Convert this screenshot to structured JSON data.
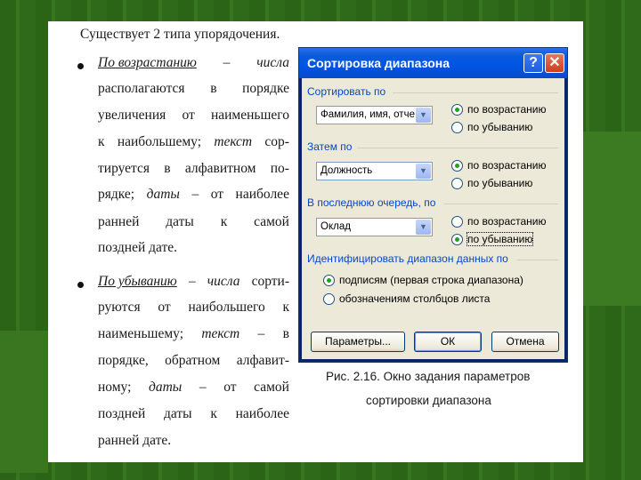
{
  "colors": {
    "background": "#2f6a1a",
    "dialog_title": "#0054e3",
    "group_label": "#0046d5",
    "client": "#ece9d8"
  },
  "text": {
    "heading": "Существует 2 типа упорядочения.",
    "b1_term": "По возрастанию",
    "b1_line1_rest": [
      "–",
      "числа"
    ],
    "b1_line2": [
      "располагаются",
      "в",
      "порядке"
    ],
    "b1_line3": [
      "увеличения",
      "от",
      "наименьшего"
    ],
    "b1_line4": [
      "к",
      "наибольшему;",
      "текст",
      "сор-"
    ],
    "b1_line5": [
      "тируется",
      "в",
      "алфавитном",
      "по-"
    ],
    "b1_line6": [
      "рядке;",
      "даты",
      "–",
      "от",
      "наиболее"
    ],
    "b1_line7": [
      "ранней",
      "даты",
      "к",
      "самой"
    ],
    "b1_line8": "поздней дате.",
    "b2_term": "По убыванию",
    "b2_line1_rest": [
      "–",
      "числа",
      "сорти-"
    ],
    "b2_line2": [
      "руются",
      "от",
      "наибольшего",
      "к"
    ],
    "b2_line3": [
      "наименьшему;",
      "текст",
      "–",
      "в"
    ],
    "b2_line4": [
      "порядке,",
      "обратном",
      "алфавит-"
    ],
    "b2_line5": [
      "ному;",
      "даты",
      "–",
      "от",
      "самой"
    ],
    "b2_line6": [
      "поздней",
      "даты",
      "к",
      "наиболее"
    ],
    "b2_line7": "ранней дате."
  },
  "dialog": {
    "title": "Сортировка диапазона",
    "help_label": "?",
    "close_label": "✕",
    "sort_by_label": "Сортировать по",
    "sort_by_value": "Фамилия, имя, отче",
    "then_by_label": "Затем по",
    "then_by_value": "Должность",
    "last_by_label": "В последнюю очередь, по",
    "last_by_value": "Оклад",
    "asc_label": "по возрастанию",
    "desc_label": "по убыванию",
    "range_label": "Идентифицировать диапазон данных по",
    "opt_headers": "подписям (первая строка диапазона)",
    "opt_cols": "обозначениям столбцов листа",
    "params_button": "Параметры...",
    "ok_button": "ОК",
    "cancel_button": "Отмена",
    "sort1_order": "asc",
    "sort2_order": "asc",
    "sort3_order": "desc",
    "range_option": "headers"
  },
  "caption": {
    "line1": "Рис. 2.16. Окно задания параметров",
    "line2": "сортировки диапазона"
  }
}
